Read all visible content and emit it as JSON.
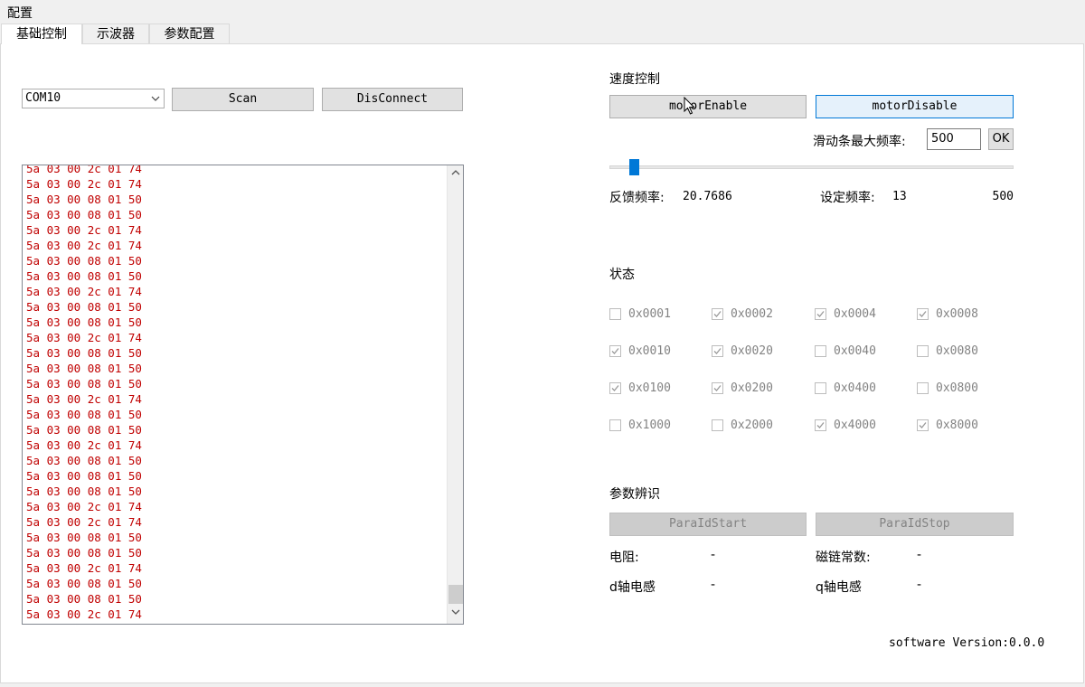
{
  "window": {
    "title": "配置"
  },
  "tabs": [
    {
      "label": "基础控制",
      "active": true
    },
    {
      "label": "示波器",
      "active": false
    },
    {
      "label": "参数配置",
      "active": false
    }
  ],
  "serial": {
    "port_value": "COM10",
    "scan_label": "Scan",
    "disconnect_label": "DisConnect"
  },
  "log": {
    "color": "#c00000",
    "lines": [
      "5a 03 00 2c 01 74",
      "5a 03 00 2c 01 74",
      "5a 03 00 08 01 50",
      "5a 03 00 08 01 50",
      "5a 03 00 2c 01 74",
      "5a 03 00 2c 01 74",
      "5a 03 00 08 01 50",
      "5a 03 00 08 01 50",
      "5a 03 00 2c 01 74",
      "5a 03 00 08 01 50",
      "5a 03 00 08 01 50",
      "5a 03 00 2c 01 74",
      "5a 03 00 08 01 50",
      "5a 03 00 08 01 50",
      "5a 03 00 08 01 50",
      "5a 03 00 2c 01 74",
      "5a 03 00 08 01 50",
      "5a 03 00 08 01 50",
      "5a 03 00 2c 01 74",
      "5a 03 00 08 01 50",
      "5a 03 00 08 01 50",
      "5a 03 00 08 01 50",
      "5a 03 00 2c 01 74",
      "5a 03 00 2c 01 74",
      "5a 03 00 08 01 50",
      "5a 03 00 08 01 50",
      "5a 03 00 2c 01 74",
      "5a 03 00 08 01 50",
      "5a 03 00 08 01 50",
      "5a 03 00 2c 01 74"
    ]
  },
  "speed": {
    "section_title": "速度控制",
    "enable_label": "motorEnable",
    "disable_label": "motorDisable",
    "max_freq_label": "滑动条最大频率:",
    "max_freq_value": "500",
    "ok_label": "OK",
    "slider_fraction": 0.026,
    "feedback_label": "反馈频率:",
    "feedback_value": "20.7686",
    "set_label": "设定频率:",
    "set_value": "13",
    "max_display": "500"
  },
  "status": {
    "section_title": "状态",
    "flags": [
      {
        "label": "0x0001",
        "checked": false
      },
      {
        "label": "0x0002",
        "checked": true
      },
      {
        "label": "0x0004",
        "checked": true
      },
      {
        "label": "0x0008",
        "checked": true
      },
      {
        "label": "0x0010",
        "checked": true
      },
      {
        "label": "0x0020",
        "checked": true
      },
      {
        "label": "0x0040",
        "checked": false
      },
      {
        "label": "0x0080",
        "checked": false
      },
      {
        "label": "0x0100",
        "checked": true
      },
      {
        "label": "0x0200",
        "checked": true
      },
      {
        "label": "0x0400",
        "checked": false
      },
      {
        "label": "0x0800",
        "checked": false
      },
      {
        "label": "0x1000",
        "checked": false
      },
      {
        "label": "0x2000",
        "checked": false
      },
      {
        "label": "0x4000",
        "checked": true
      },
      {
        "label": "0x8000",
        "checked": true
      }
    ]
  },
  "param_id": {
    "section_title": "参数辨识",
    "start_label": "ParaIdStart",
    "stop_label": "ParaIdStop",
    "resistance_label": "电阻:",
    "resistance_value": "-",
    "flux_label": "磁链常数:",
    "flux_value": "-",
    "ld_label": "d轴电感",
    "ld_value": "-",
    "lq_label": "q轴电感",
    "lq_value": "-"
  },
  "footer": {
    "version": "software Version:0.0.0"
  },
  "icons": {
    "combo_arrow": "chevron-down-icon",
    "scroll_up": "chevron-up-icon",
    "scroll_down": "chevron-down-icon",
    "check": "check-icon",
    "cursor": "mouse-pointer-icon"
  }
}
